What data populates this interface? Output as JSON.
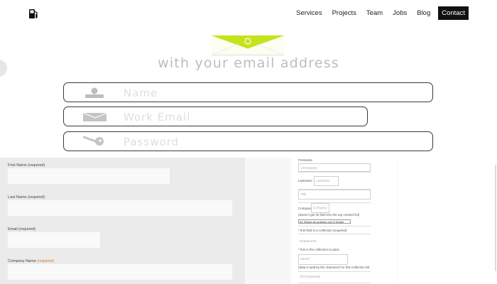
{
  "nav": {
    "logo_icon": "fuel-pump-icon",
    "items": [
      "Services",
      "Projects",
      "Team",
      "Jobs",
      "Blog"
    ],
    "contact_label": "Contact"
  },
  "hero": {
    "envelope_icon": "email-envelope-icon",
    "accent": "#c6e21a",
    "tagline": "with your email address",
    "fields": [
      {
        "icon": "user-icon",
        "placeholder": "Name"
      },
      {
        "icon": "envelope-icon",
        "placeholder": "Work Email"
      },
      {
        "icon": "key-icon",
        "placeholder": "Password"
      }
    ]
  },
  "signup_form": {
    "labels": [
      {
        "text": "First Name",
        "req": "(required)"
      },
      {
        "text": "Last Name",
        "req": "(required)"
      },
      {
        "text": "Email",
        "req": "(required)"
      },
      {
        "text": "Company Name",
        "req": "(required)"
      }
    ]
  },
  "document_form": {
    "first_label": "Firstname",
    "first_placeholder": "1.Firstname",
    "last_label": "Lastname",
    "last_placeholder": "Lastname",
    "title_placeholder": "Title",
    "company_label": "Company",
    "company_placeholder": "Company",
    "note1": "(doesn't get its field into the org contact list)",
    "select_value": "A1 Whole tbl ordering Ltd (2 Kinds)",
    "note2": "* this field is a collection (required)",
    "field_a_placeholder": "Department",
    "note3": "* this is the collection to pass",
    "field_b_placeholder": "Street*",
    "note4": "(data is split by the character) for this collection list",
    "field_c_placeholder": "City*(required)"
  }
}
